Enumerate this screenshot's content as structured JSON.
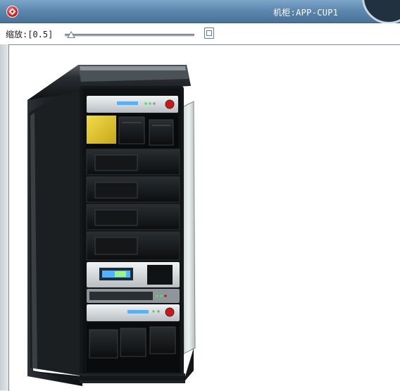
{
  "window": {
    "title": "机柜:APP-CUP1",
    "app_icon": "app-logo-icon"
  },
  "toolbar": {
    "zoom_label": "缩放:[0.5]",
    "zoom_value": 0.5,
    "export_icon": "document-icon"
  },
  "canvas": {
    "rack_image": "server-rack-cabinet"
  },
  "colors": {
    "titlebar": "#5e88b0",
    "canvas_background": "#ffffff",
    "rack_body": "#1c1f22",
    "led_blue": "#4fb3ff",
    "led_green": "#53e05a",
    "power_red": "#d41414",
    "drive_yellow": "#e7cf2e"
  }
}
